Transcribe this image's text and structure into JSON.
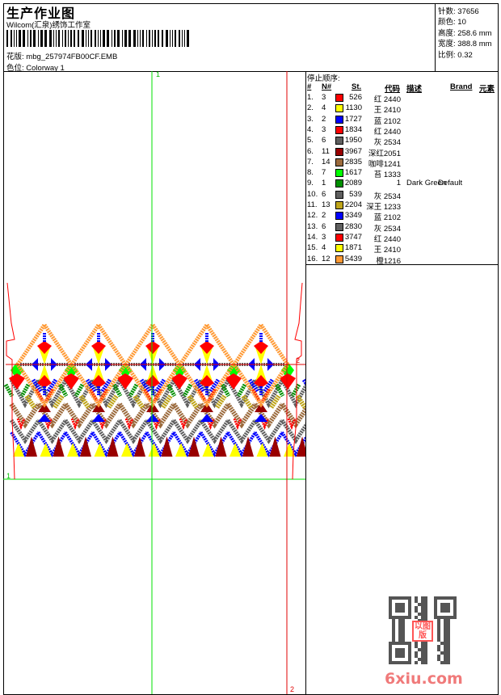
{
  "header": {
    "title": "生产作业图",
    "company": "Wilcom(汇泉)绣饰工作室",
    "pattern_label": "花版:",
    "pattern_value": "mbg_257974FB00CF.EMB",
    "colorway_label": "色位:",
    "colorway_value": "Colorway 1"
  },
  "info": [
    {
      "label": "针数:",
      "value": "37656"
    },
    {
      "label": "颜色:",
      "value": "10"
    },
    {
      "label": "高度:",
      "value": "258.6 mm"
    },
    {
      "label": "宽度:",
      "value": "388.8 mm"
    },
    {
      "label": "比例:",
      "value": "0.32"
    }
  ],
  "stop_sequence": {
    "title": "停止顺序:",
    "columns": {
      "idx": "#",
      "needle": "N#",
      "stitches": "St.",
      "code": "代码",
      "desc": "描述",
      "brand": "Brand",
      "element": "元素"
    },
    "rows": [
      {
        "idx": "1.",
        "needle": "3",
        "color": "#ff0000",
        "stitches": "526",
        "code": "红 2440",
        "desc": "",
        "brand": ""
      },
      {
        "idx": "2.",
        "needle": "4",
        "color": "#ffff00",
        "stitches": "1130",
        "code": "王 2410",
        "desc": "",
        "brand": ""
      },
      {
        "idx": "3.",
        "needle": "2",
        "color": "#0000ff",
        "stitches": "1727",
        "code": "蓝 2102",
        "desc": "",
        "brand": ""
      },
      {
        "idx": "4.",
        "needle": "3",
        "color": "#ff0000",
        "stitches": "1834",
        "code": "红 2440",
        "desc": "",
        "brand": ""
      },
      {
        "idx": "5.",
        "needle": "6",
        "color": "#5f5f5f",
        "stitches": "1950",
        "code": "灰 2534",
        "desc": "",
        "brand": ""
      },
      {
        "idx": "6.",
        "needle": "11",
        "color": "#990000",
        "stitches": "3967",
        "code": "深红2051",
        "desc": "",
        "brand": ""
      },
      {
        "idx": "7.",
        "needle": "14",
        "color": "#9b6a3c",
        "stitches": "2835",
        "code": "咖啡1241",
        "desc": "",
        "brand": ""
      },
      {
        "idx": "8.",
        "needle": "7",
        "color": "#00ff00",
        "stitches": "1617",
        "code": "苔 1333",
        "desc": "",
        "brand": ""
      },
      {
        "idx": "9.",
        "needle": "1",
        "color": "#008f00",
        "stitches": "2089",
        "code": "1",
        "desc": "Dark Green",
        "brand": "Default"
      },
      {
        "idx": "10.",
        "needle": "6",
        "color": "#5f5f5f",
        "stitches": "539",
        "code": "灰 2534",
        "desc": "",
        "brand": ""
      },
      {
        "idx": "11.",
        "needle": "13",
        "color": "#bfa51a",
        "stitches": "2204",
        "code": "深王 1233",
        "desc": "",
        "brand": ""
      },
      {
        "idx": "12.",
        "needle": "2",
        "color": "#0000ff",
        "stitches": "3349",
        "code": "蓝 2102",
        "desc": "",
        "brand": ""
      },
      {
        "idx": "13.",
        "needle": "6",
        "color": "#5f5f5f",
        "stitches": "2830",
        "code": "灰 2534",
        "desc": "",
        "brand": ""
      },
      {
        "idx": "14.",
        "needle": "3",
        "color": "#ff0000",
        "stitches": "3747",
        "code": "红 2440",
        "desc": "",
        "brand": ""
      },
      {
        "idx": "15.",
        "needle": "4",
        "color": "#ffff00",
        "stitches": "1871",
        "code": "王 2410",
        "desc": "",
        "brand": ""
      },
      {
        "idx": "16.",
        "needle": "12",
        "color": "#ff9933",
        "stitches": "5439",
        "code": "橙1216",
        "desc": "",
        "brand": ""
      }
    ]
  },
  "guides": {
    "green_v": "1",
    "green_h": "1",
    "red_v": "2",
    "red_h": "2"
  },
  "watermark": {
    "logo": "6xiu.com",
    "stamp": "以图版"
  }
}
